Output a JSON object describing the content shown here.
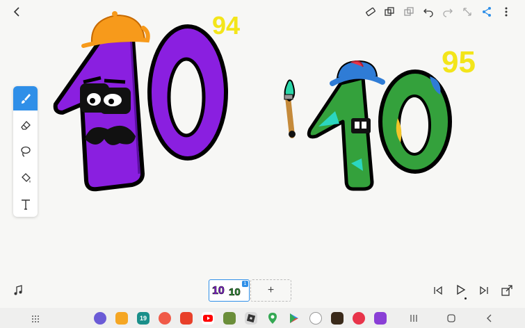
{
  "top_toolbar": {
    "back_icon": "chevron-left-icon",
    "actions": [
      "ruler-icon",
      "layers-icon",
      "copy-icon",
      "undo-icon",
      "redo-icon",
      "resize-icon",
      "share-icon",
      "more-icon"
    ]
  },
  "canvas": {
    "labels": {
      "left_number": "94",
      "right_number": "95"
    }
  },
  "tools": [
    "brush-icon",
    "eraser-icon",
    "lasso-icon",
    "fill-icon",
    "text-icon"
  ],
  "timeline": {
    "music_icon": "music-note-icon",
    "frame_badge": "1",
    "add_frame_label": "+",
    "controls": [
      "skip-start-icon",
      "play-icon",
      "skip-end-icon",
      "export-icon"
    ]
  },
  "taskbar": {
    "apps_grid_icon": "apps-grid-icon",
    "calendar_day": "19",
    "nav": [
      "recents-icon",
      "home-icon",
      "back-icon"
    ]
  },
  "colors": {
    "accent": "#2f8fe8",
    "purple": "#8a1fe0",
    "green": "#34a13c",
    "hat_orange": "#f79a1b",
    "number_yellow": "#f3e51a"
  }
}
